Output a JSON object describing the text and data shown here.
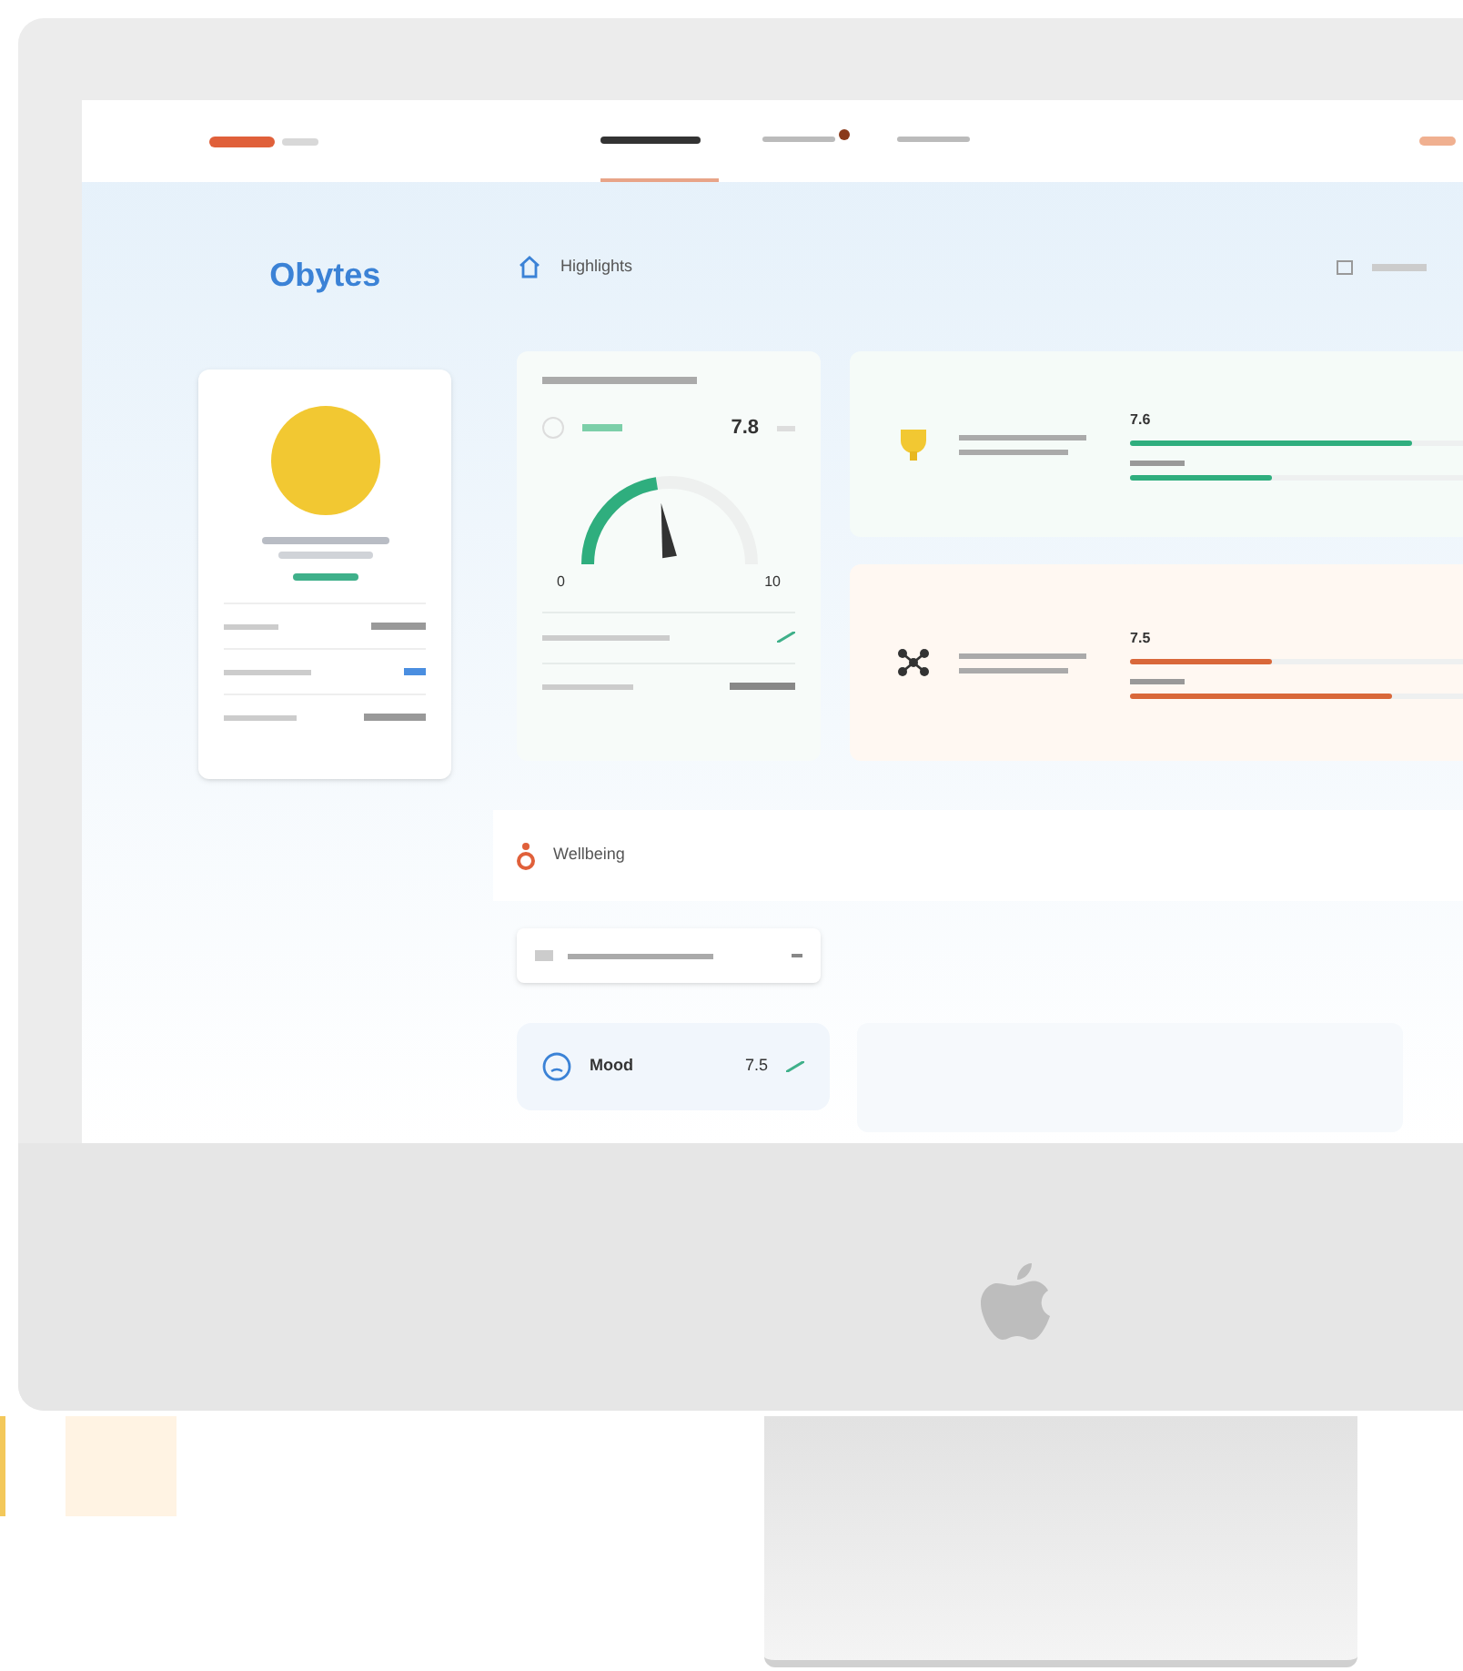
{
  "nav": {
    "tabs": [
      {
        "selected": true,
        "badge": false
      },
      {
        "selected": false,
        "badge": true
      },
      {
        "selected": false,
        "badge": false
      }
    ]
  },
  "sidebar": {
    "company": "Obytes"
  },
  "highlights": {
    "title": "Highlights",
    "score_card": {
      "value": "7.8",
      "level": 0.45,
      "min": "0",
      "max": "10"
    },
    "cards": [
      {
        "kind": "positive",
        "value": "7.6",
        "color": "#2fae7e",
        "bars": [
          {
            "level": 0.7
          },
          {
            "level": 0.35
          }
        ]
      },
      {
        "kind": "negative",
        "value": "7.5",
        "color": "#d9683a",
        "bars": [
          {
            "level": 0.35
          },
          {
            "level": 0.65
          }
        ]
      }
    ]
  },
  "wellbeing": {
    "title": "Wellbeing",
    "mood": {
      "label": "Mood",
      "value": "7.5"
    }
  }
}
